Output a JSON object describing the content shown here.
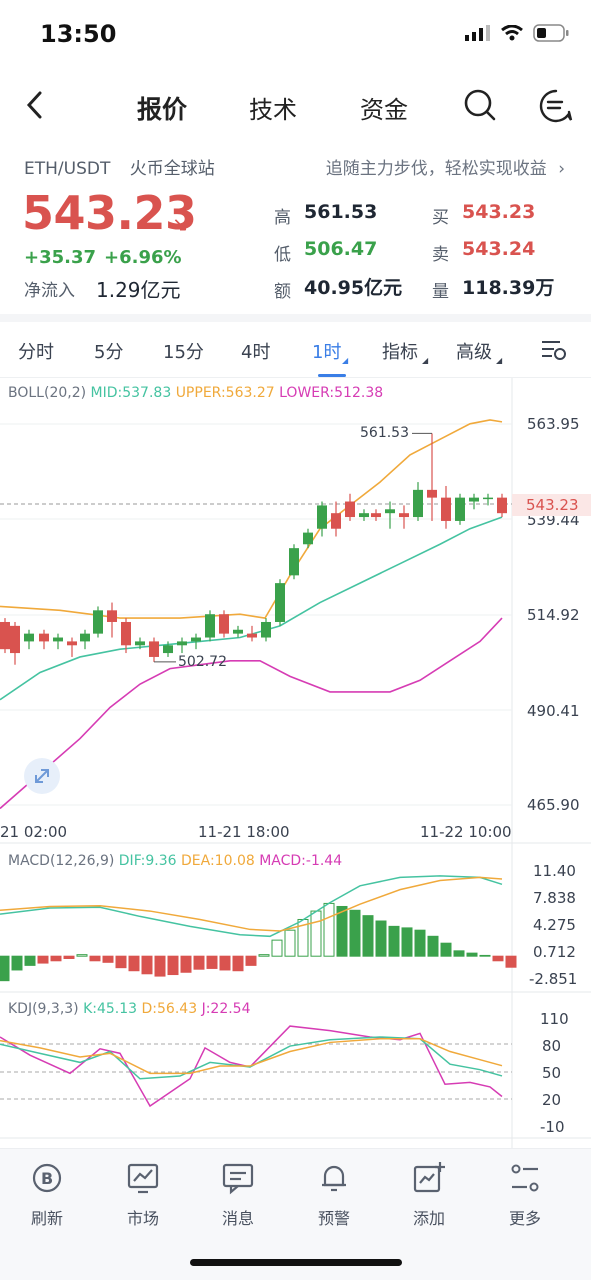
{
  "status_bar": {
    "time": "13:50"
  },
  "nav": {
    "tabs": [
      "报价",
      "技术",
      "资金"
    ],
    "active_tab": "报价"
  },
  "header": {
    "pair": "ETH/USDT",
    "exchange": "火币全球站",
    "promo": "追随主力步伐，轻松实现收益",
    "price": "543.23",
    "change": "+35.37",
    "change_pct": "+6.96%",
    "net_inflow_label": "净流入",
    "net_inflow_value": "1.29亿元",
    "stats": {
      "high_label": "高",
      "high": "561.53",
      "low_label": "低",
      "low": "506.47",
      "amount_label": "额",
      "amount": "40.95亿元",
      "buy_label": "买",
      "buy": "543.23",
      "sell_label": "卖",
      "sell": "543.24",
      "volume_label": "量",
      "volume": "118.39万"
    }
  },
  "intervals": {
    "tabs": [
      "分时",
      "5分",
      "15分",
      "4时",
      "1时",
      "指标",
      "高级"
    ],
    "active": "1时"
  },
  "boll": {
    "label": "BOLL(20,2)",
    "mid": "MID:537.83",
    "upper": "UPPER:563.27",
    "lower": "LOWER:512.38",
    "axis": [
      "563.95",
      "539.44",
      "514.92",
      "490.41",
      "465.90"
    ],
    "current_price_tag": "543.23",
    "high_marker": "561.53",
    "low_marker": "502.72",
    "time_labels": [
      "21 02:00",
      "11-21 18:00",
      "11-22 10:00"
    ]
  },
  "macd": {
    "label": "MACD(12,26,9)",
    "dif": "DIF:9.36",
    "dea": "DEA:10.08",
    "macd": "MACD:-1.44",
    "axis": [
      "11.40",
      "7.838",
      "4.275",
      "0.712",
      "-2.851"
    ],
    "histogram": [
      -3.2,
      -1.8,
      -1.2,
      -0.9,
      -0.6,
      -0.3,
      0.2,
      -0.6,
      -0.8,
      -1.5,
      -1.9,
      -2.3,
      -2.6,
      -2.4,
      -2.1,
      -1.7,
      -1.6,
      -1.8,
      -1.9,
      -1.2,
      0.2,
      2.1,
      3.4,
      4.8,
      5.9,
      6.9,
      6.5,
      6.0,
      5.3,
      4.6,
      3.9,
      3.7,
      3.4,
      2.6,
      1.7,
      0.7,
      0.4,
      0.1,
      -0.6,
      -1.44
    ]
  },
  "kdj": {
    "label": "KDJ(9,3,3)",
    "k": "K:45.13",
    "d": "D:56.43",
    "j": "J:22.54",
    "axis": [
      "110",
      "80",
      "50",
      "20",
      "-10"
    ]
  },
  "bottom_bar": {
    "items": [
      "刷新",
      "市场",
      "消息",
      "预警",
      "添加",
      "更多"
    ]
  },
  "colors": {
    "up": "#3aa14b",
    "down": "#d9534f",
    "accent": "#3a7ee6",
    "mid": "#45c3a1",
    "upper": "#f0a93b",
    "lower": "#d63cb4"
  }
}
